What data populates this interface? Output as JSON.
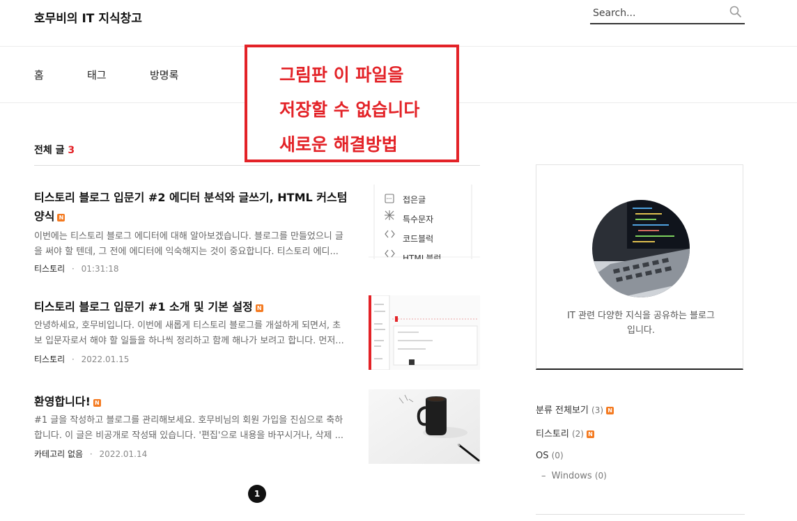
{
  "header": {
    "site_title": "호무비의 IT 지식창고",
    "search_placeholder": "Search..."
  },
  "nav": {
    "items": [
      "홈",
      "태그",
      "방명록"
    ]
  },
  "overlay": {
    "lines": [
      "그림판 이 파일을",
      "저장할 수 없습니다",
      "새로운 해결방법"
    ]
  },
  "section": {
    "label": "전체 글",
    "count": "3"
  },
  "posts": [
    {
      "title": "티스토리 블로그 입문기 #2 에디터 분석와 글쓰기, HTML 커스텀 양식",
      "excerpt": "이번에는 티스토리 블로그 에디터에 대해 알아보겠습니다. 블로그를 만들었으니 글을 써야 할 텐데, 그 전에 에디터에 익숙해지는 것이 중요합니다. 티스토리 에디...",
      "category": "티스토리",
      "sep": "·",
      "date": "01:31:18",
      "new_badge": "N",
      "thumb_menu": [
        "접은글",
        "특수문자",
        "코드블럭",
        "HTML블럭"
      ]
    },
    {
      "title": "티스토리 블로그 입문기 #1 소개 및 기본 설정",
      "excerpt": "안녕하세요, 호무비입니다. 이번에 새롭게 티스토리 블로그를 개설하게 되면서, 초보 입문자로서 해야 할 일들을 하나씩 정리하고 함께 해나가 보려고 합니다. 먼저...",
      "category": "티스토리",
      "sep": "·",
      "date": "2022.01.15",
      "new_badge": "N"
    },
    {
      "title": "환영합니다!",
      "excerpt": "#1 글을 작성하고 블로그를 관리해보세요. 호무비님의 회원 가입을 진심으로 축하합니다. 이 글은 비공개로 작성돼 있습니다. '편집'으로 내용을 바꾸시거나, 삭제 ...",
      "category": "카테고리 없음",
      "sep": "·",
      "date": "2022.01.14",
      "new_badge": "N"
    }
  ],
  "pagination": {
    "current": "1"
  },
  "sidebar": {
    "description": "IT 관련 다양한 지식을 공유하는 블로그입니다.",
    "categories": [
      {
        "label": "분류 전체보기",
        "count": "(3)",
        "new_badge": "N"
      },
      {
        "label": "티스토리",
        "count": "(2)",
        "new_badge": "N"
      },
      {
        "label": "OS",
        "count": "(0)"
      },
      {
        "label": "Windows",
        "count": "(0)",
        "prefix": "–"
      }
    ]
  },
  "colors": {
    "accent_red": "#e32227",
    "badge_orange": "#f47a20"
  }
}
